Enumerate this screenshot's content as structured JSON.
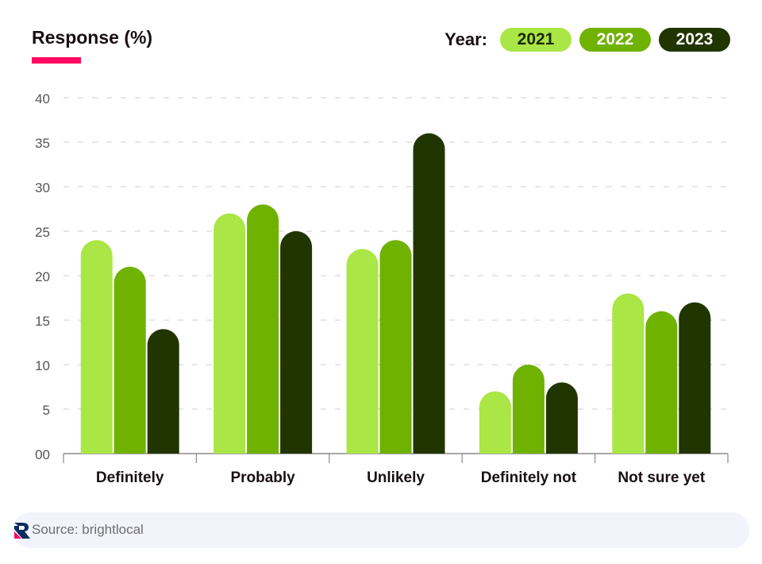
{
  "header": {
    "title": "Response (%)",
    "legend_label": "Year:"
  },
  "colors": {
    "accent": "#ff0a62",
    "2021": "#aae645",
    "2022": "#6fb200",
    "2023": "#213500",
    "grid": "#d6d6d6",
    "axis": "#8a8a8a",
    "tick_text": "#555555",
    "category_text": "#1a0f14"
  },
  "legend": [
    {
      "label": "2021",
      "color": "#aae645",
      "text_color": "#1a2a00"
    },
    {
      "label": "2022",
      "color": "#6fb200",
      "text_color": "#ffffff"
    },
    {
      "label": "2023",
      "color": "#213500",
      "text_color": "#ffffff"
    }
  ],
  "chart_data": {
    "type": "bar",
    "title": "Response (%)",
    "xlabel": "",
    "ylabel": "Response (%)",
    "categories": [
      "Definitely",
      "Probably",
      "Unlikely",
      "Definitely not",
      "Not sure yet"
    ],
    "series": [
      {
        "name": "2021",
        "values": [
          24,
          27,
          23,
          7,
          18
        ]
      },
      {
        "name": "2022",
        "values": [
          21,
          28,
          24,
          10,
          16
        ]
      },
      {
        "name": "2023",
        "values": [
          14,
          25,
          36,
          8,
          17
        ]
      }
    ],
    "ylim": [
      0,
      40
    ],
    "yticks": [
      "00",
      "5",
      "10",
      "15",
      "20",
      "25",
      "30",
      "35",
      "40"
    ],
    "ytick_values": [
      0,
      5,
      10,
      15,
      20,
      25,
      30,
      35,
      40
    ],
    "grid": true,
    "legend_position": "top-right"
  },
  "footer": {
    "source": "Source: brightlocal",
    "logo": "brand-logo-icon"
  }
}
